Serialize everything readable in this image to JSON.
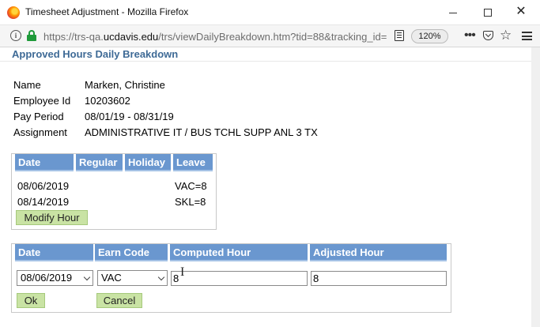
{
  "window": {
    "title": "Timesheet Adjustment - Mozilla Firefox",
    "minimize_glyph": "",
    "close_glyph": "✕"
  },
  "urlbar": {
    "url_prefix": "https://trs-qa.",
    "url_host": "ucdavis.edu",
    "url_rest": "/trs/viewDailyBreakdown.htm?tid=88&tracking_id=",
    "zoom": "120%",
    "info_glyph": "i",
    "more_glyph": "•••",
    "star_glyph": "☆"
  },
  "page": {
    "title": "Approved Hours Daily Breakdown"
  },
  "employee": [
    {
      "label": "Name",
      "value": "Marken, Christine"
    },
    {
      "label": "Employee Id",
      "value": "10203602"
    },
    {
      "label": "Pay Period",
      "value": "08/01/19 - 08/31/19"
    },
    {
      "label": "Assignment",
      "value": "ADMINISTRATIVE IT / BUS TCHL SUPP ANL 3 TX"
    }
  ],
  "hours_table": {
    "headers": [
      "Date",
      "Regular",
      "Holiday",
      "Leave"
    ],
    "rows": [
      {
        "date": "08/06/2019",
        "regular": "",
        "holiday": "",
        "leave": "VAC=8"
      },
      {
        "date": "08/14/2019",
        "regular": "",
        "holiday": "",
        "leave": "SKL=8"
      }
    ],
    "modify_button": "Modify Hour"
  },
  "edit_form": {
    "headers": [
      "Date",
      "Earn Code",
      "Computed Hour",
      "Adjusted Hour"
    ],
    "date_selected": "08/06/2019",
    "earn_code_selected": "VAC",
    "computed_hour": "8",
    "adjusted_hour": "8",
    "ok_button": "Ok",
    "cancel_button": "Cancel"
  },
  "colors": {
    "header_bg": "#6a97cf",
    "title_text": "#3e6a96",
    "button_bg": "#c9e3a4"
  },
  "icons": [
    "firefox-logo-icon",
    "info-icon",
    "lock-icon",
    "reader-view-icon",
    "more-icon",
    "pocket-icon",
    "bookmark-star-icon",
    "hamburger-menu-icon"
  ]
}
